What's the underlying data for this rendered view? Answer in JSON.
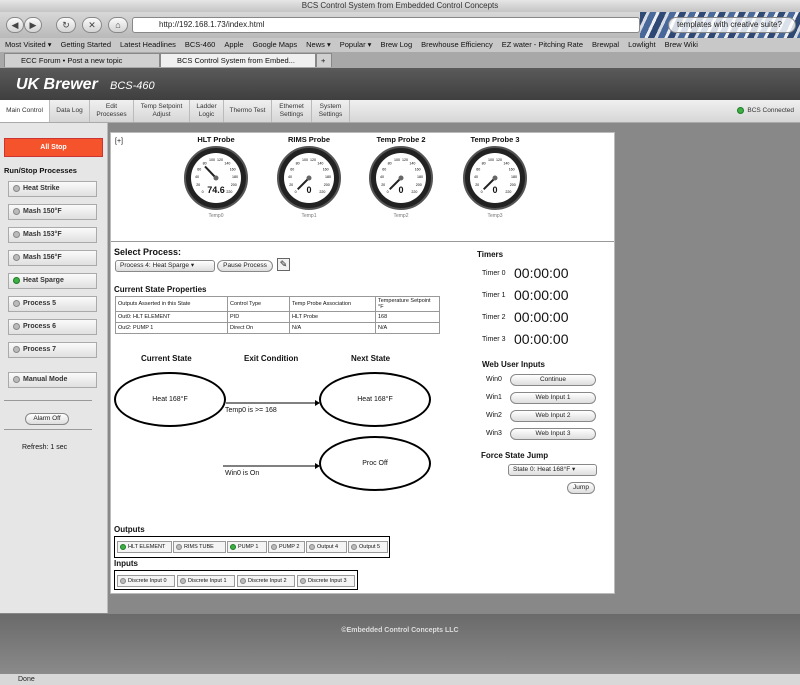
{
  "browser": {
    "title": "BCS Control System from Embedded Control Concepts",
    "url": "http://192.168.1.73/index.html",
    "search": "templates with creative suite?",
    "bookmarks": [
      "Most Visited ▾",
      "Getting Started",
      "Latest Headlines",
      "BCS-460",
      "Apple",
      "Google Maps",
      "News ▾",
      "Popular ▾",
      "Brew Log",
      "Brewhouse Efficiency",
      "EZ water - Pitching Rate",
      "Brewpal",
      "Lowlight",
      "Brew Wiki"
    ],
    "tabs": [
      "ECC Forum • Post a new topic",
      "BCS Control System from Embed..."
    ],
    "status": "Done"
  },
  "header": {
    "brand": "UK Brewer",
    "model": "BCS-460"
  },
  "menu": [
    "Main Control",
    "Data Log",
    "Edit Processes",
    "Temp Setpoint Adjust",
    "Ladder Logic",
    "Thermo Test",
    "Ethernet Settings",
    "System Settings"
  ],
  "connection": "BCS Connected",
  "left": {
    "all_stop": "All Stop",
    "heading": "Run/Stop Processes",
    "processes": [
      {
        "label": "Heat Strike",
        "active": false
      },
      {
        "label": "Mash 150°F",
        "active": false
      },
      {
        "label": "Mash 153°F",
        "active": false
      },
      {
        "label": "Mash 156°F",
        "active": false
      },
      {
        "label": "Heat Sparge",
        "active": true
      },
      {
        "label": "Process 5",
        "active": false
      },
      {
        "label": "Process 6",
        "active": false
      },
      {
        "label": "Process 7",
        "active": false
      }
    ],
    "manual": "Manual Mode",
    "alarm": "Alarm Off",
    "refresh": "Refresh: 1 sec"
  },
  "expand": "[+]",
  "gauges": [
    {
      "title": "HLT Probe",
      "value": "74.6",
      "sub": "Temp0"
    },
    {
      "title": "RIMS Probe",
      "value": "0",
      "sub": "Temp1"
    },
    {
      "title": "Temp Probe 2",
      "value": "0",
      "sub": "Temp2"
    },
    {
      "title": "Temp Probe 3",
      "value": "0",
      "sub": "Temp3"
    }
  ],
  "gauge_ticks": [
    "80",
    "100",
    "120",
    "140",
    "160",
    "180",
    "200",
    "220",
    "60",
    "40",
    "20",
    "0"
  ],
  "select_process": {
    "heading": "Select Process:",
    "value": "Process 4: Heat Sparge ▾",
    "pause": "Pause Process"
  },
  "state_props": {
    "heading": "Current State Properties",
    "headers": [
      "Outputs Asserted in this State",
      "Control Type",
      "Temp Probe Association",
      "Temperature Setpoint °F"
    ],
    "rows": [
      [
        "Out0: HLT ELEMENT",
        "PID",
        "HLT Probe",
        "168"
      ],
      [
        "Out2: PUMP 1",
        "Direct On",
        "N/A",
        "N/A"
      ]
    ]
  },
  "flow": {
    "col_current": "Current State",
    "col_exit": "Exit Condition",
    "col_next": "Next State",
    "current": "Heat 168°F",
    "next1": "Heat 168°F",
    "cond1": "Temp0 is >= 168",
    "next2": "Proc Off",
    "cond2": "Win0 is On"
  },
  "timers": {
    "heading": "Timers",
    "items": [
      {
        "label": "Timer 0",
        "value": "00:00:00"
      },
      {
        "label": "Timer 1",
        "value": "00:00:00"
      },
      {
        "label": "Timer 2",
        "value": "00:00:00"
      },
      {
        "label": "Timer 3",
        "value": "00:00:00"
      }
    ]
  },
  "web_inputs": {
    "heading": "Web User Inputs",
    "items": [
      {
        "label": "Win0",
        "button": "Continue"
      },
      {
        "label": "Win1",
        "button": "Web Input 1"
      },
      {
        "label": "Win2",
        "button": "Web Input 2"
      },
      {
        "label": "Win3",
        "button": "Web Input 3"
      }
    ]
  },
  "force": {
    "heading": "Force State Jump",
    "value": "State 0: Heat 168°F ▾",
    "jump": "Jump"
  },
  "outputs": {
    "heading": "Outputs",
    "items": [
      {
        "label": "HLT ELEMENT",
        "on": true
      },
      {
        "label": "RIMS TUBE",
        "on": false
      },
      {
        "label": "PUMP 1",
        "on": true
      },
      {
        "label": "PUMP 2",
        "on": false
      },
      {
        "label": "Output 4",
        "on": false
      },
      {
        "label": "Output 5",
        "on": false
      }
    ]
  },
  "inputs": {
    "heading": "Inputs",
    "items": [
      "Discrete Input 0",
      "Discrete Input 1",
      "Discrete Input 2",
      "Discrete Input 3"
    ]
  },
  "footer": "©Embedded Control Concepts LLC"
}
